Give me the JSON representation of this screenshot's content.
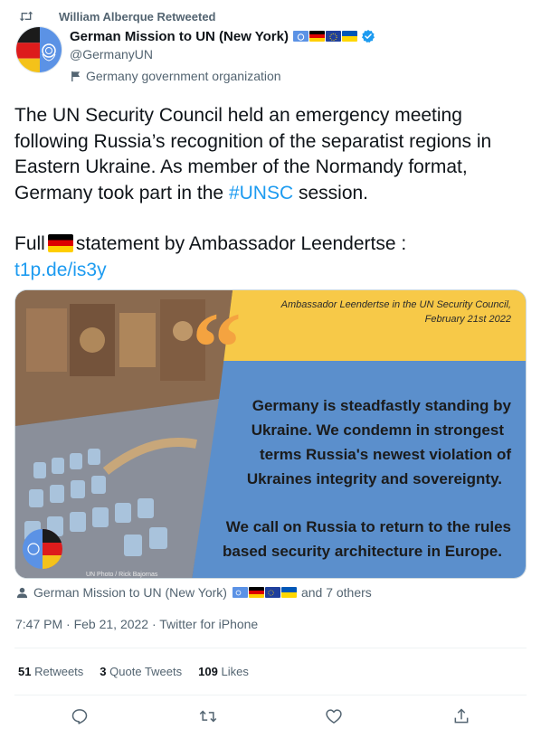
{
  "retweet": {
    "label": "William Alberque Retweeted",
    "icon": "retweet-icon"
  },
  "author": {
    "display_name": "German Mission to UN (New York)",
    "handle": "@GermanyUN",
    "affiliation": "Germany government organization",
    "verified": true,
    "name_flags": [
      "un-flag",
      "germany-flag",
      "eu-flag",
      "ukraine-flag"
    ]
  },
  "tweet": {
    "text_1a": "The UN Security Council held an emergency meeting following Russia’s recognition of the separatist regions in Eastern Ukraine. As member of the Normandy format, Germany took part in the ",
    "hashtag": "#UNSC",
    "text_1b": " session.",
    "text_2a": "Full",
    "text_2b": "statement by Ambassador Leendertse :",
    "link": "t1p.de/is3y"
  },
  "media": {
    "caption": "Ambassador Leendertse in the UN Security Council,",
    "date": "February 21st 2022",
    "quote_mark": "“",
    "quote_line_1": "Germany is steadfastly standing by",
    "quote_line_2": "Ukraine. We condemn in strongest",
    "quote_line_3": "terms Russia's newest violation of",
    "quote_line_4": "Ukraines integrity and sovereignty.",
    "quote_line_5": "We call on Russia to return to the rules",
    "quote_line_6": "based security architecture in Europe.",
    "photo_credit": "UN Photo / Rick Bajornas",
    "colors": {
      "yellow": "#f7c948",
      "blue": "#5b8fcc",
      "dark": "#1b1b1b"
    }
  },
  "tagged": {
    "name": "German Mission to UN (New York)",
    "others": "and 7 others"
  },
  "meta": {
    "timestamp": "7:47 PM · Feb 21, 2022 · Twitter for iPhone"
  },
  "stats": {
    "retweets_count": "51",
    "retweets_label": "Retweets",
    "quotes_count": "3",
    "quotes_label": "Quote Tweets",
    "likes_count": "109",
    "likes_label": "Likes"
  },
  "actions": [
    "reply-icon",
    "retweet-icon",
    "like-icon",
    "share-icon"
  ],
  "colors": {
    "link": "#1d9bf0",
    "verified": "#1d9bf0",
    "secondary_text": "#536471"
  }
}
